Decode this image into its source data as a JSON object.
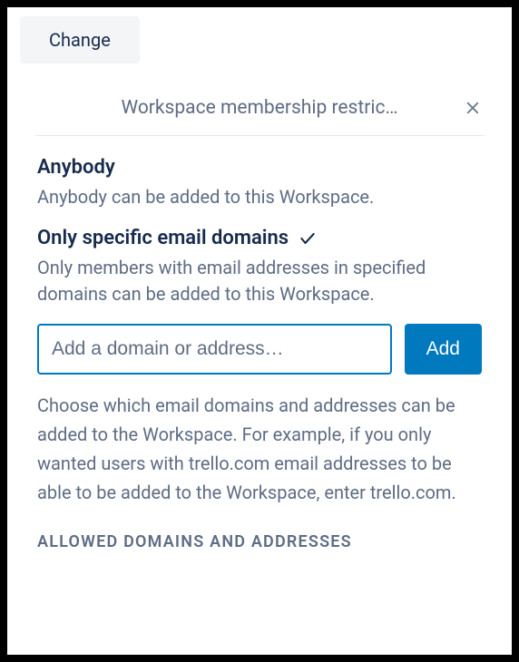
{
  "change_button": "Change",
  "popover": {
    "title": "Workspace membership restric…",
    "option_anybody": {
      "title": "Anybody",
      "desc": "Anybody can be added to this Workspace."
    },
    "option_specific": {
      "title": "Only specific email domains",
      "desc": "Only members with email addresses in specified domains can be added to this Workspace."
    },
    "input_placeholder": "Add a domain or address…",
    "add_button": "Add",
    "helper": "Choose which email domains and addresses can be added to the Workspace. For example, if you only wanted users with trello.com email addresses to be able to be added to the Workspace, enter trello.com.",
    "allowed_header": "ALLOWED DOMAINS AND ADDRESSES"
  }
}
